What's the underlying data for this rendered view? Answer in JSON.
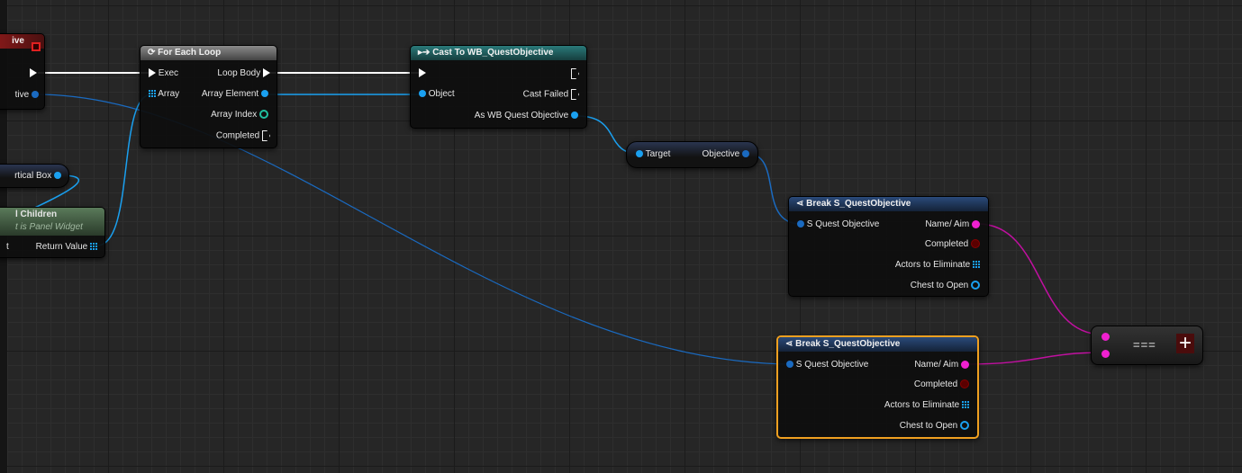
{
  "colors": {
    "exec": "#ffffff",
    "object": "#1aa0f0",
    "string": "#f020d0",
    "bool": "#8a0000",
    "int": "#20c0a0",
    "selection": "#f0a020"
  },
  "left_node": {
    "title_fragment": "ive",
    "pin_fragment": "tive"
  },
  "vertical_box": {
    "label": "rtical Box"
  },
  "get_children": {
    "title_fragment": "l Children",
    "subtitle_fragment": "t is Panel Widget",
    "input_fragment": "t",
    "output": "Return Value"
  },
  "for_each": {
    "icon": "loop-icon",
    "title": "For Each Loop",
    "inputs": [
      "Exec",
      "Array"
    ],
    "outputs": [
      "Loop Body",
      "Array Element",
      "Array Index",
      "Completed"
    ]
  },
  "cast": {
    "icon": "cast-icon",
    "title": "Cast To WB_QuestObjective",
    "input": "Object",
    "outputs": [
      "Cast Failed",
      "As WB Quest Objective"
    ]
  },
  "getter": {
    "input": "Target",
    "output": "Objective"
  },
  "break1": {
    "icon": "break-struct-icon",
    "title": "Break S_QuestObjective",
    "input": "S Quest Objective",
    "outputs": [
      "Name/ Aim",
      "Completed",
      "Actors to Eliminate",
      "Chest to Open"
    ]
  },
  "break2": {
    "icon": "break-struct-icon",
    "title": "Break S_QuestObjective",
    "input": "S Quest Objective",
    "outputs": [
      "Name/ Aim",
      "Completed",
      "Actors to Eliminate",
      "Chest to Open"
    ]
  },
  "equal": {
    "label": "===",
    "add_pin": "+"
  }
}
